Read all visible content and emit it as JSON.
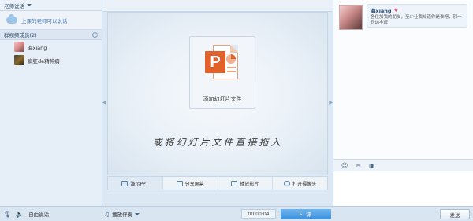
{
  "left": {
    "role_selector": "老师说话",
    "speak_prompt": "上课的老师可以说话",
    "members_header": "群视频成员(2)",
    "members": [
      {
        "name": "海xiang"
      },
      {
        "name": "疯狂de精神病"
      }
    ]
  },
  "stage": {
    "add_slides_label": "添加幻灯片文件",
    "drag_hint": "或将幻灯片文件直接拖入"
  },
  "tabs": [
    {
      "label": "演示PPT",
      "active": true
    },
    {
      "label": "分享屏幕"
    },
    {
      "label": "播放影片"
    },
    {
      "label": "打开摄像头"
    }
  ],
  "chat": {
    "sender": "海xiang",
    "message": "各位加我的朋友，至少让我知道你是谁吧，别一句话不说"
  },
  "bottom": {
    "free_talk_label": "自由说话",
    "music_label": "播放伴奏",
    "timer": "00:00:04",
    "end_class_label": "下课",
    "send_label": "发送"
  }
}
